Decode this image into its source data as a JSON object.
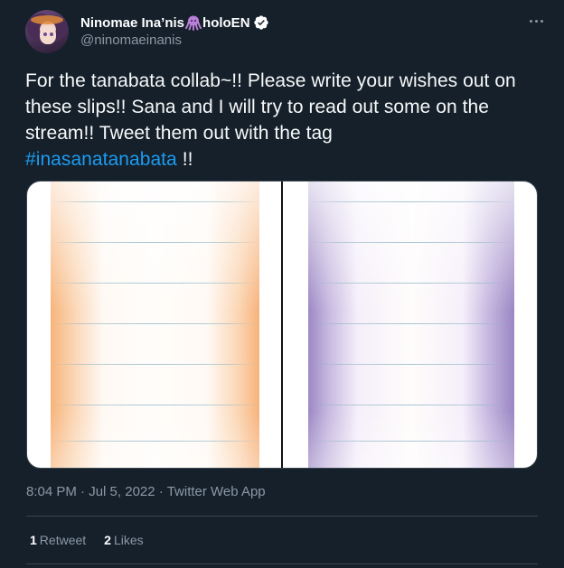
{
  "author": {
    "display_name_prefix": "Ninomae Ina’nis",
    "display_name_suffix": "holoEN",
    "name_emoji": "octopus-icon",
    "handle": "@ninomaeinanis",
    "verified": true
  },
  "tweet": {
    "text_plain": "For the tanabata collab~!! Please write your wishes out on these slips!! Sana and I will try to read out some on the stream!! Tweet them out with the tag",
    "hashtag": "#inasanatanabata",
    "text_suffix": "!!"
  },
  "media": {
    "slips": [
      {
        "name": "orange-slip",
        "accent": "#f7b47b"
      },
      {
        "name": "purple-slip",
        "accent": "#9c88c4"
      }
    ]
  },
  "meta": {
    "time": "8:04 PM",
    "sep1": "·",
    "date": "Jul 5, 2022",
    "sep2": "·",
    "source": "Twitter Web App"
  },
  "stats": {
    "retweets_count": "1",
    "retweets_label": "Retweet",
    "likes_count": "2",
    "likes_label": "Likes"
  },
  "colors": {
    "background": "#15202b",
    "link": "#1d9bf0",
    "secondary_text": "#8b98a5",
    "border": "#38444d"
  }
}
